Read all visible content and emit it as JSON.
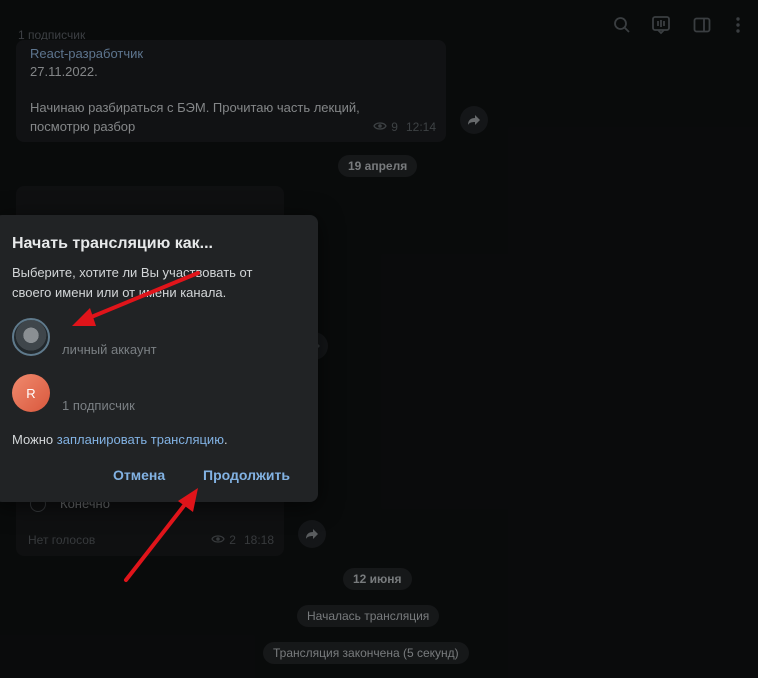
{
  "header": {
    "subscribers": "1 подписчик",
    "icons": [
      "search-icon",
      "stream-icon",
      "sidebar-toggle-icon",
      "more-icon"
    ]
  },
  "messages": [
    {
      "link": "React-разработчик",
      "date": "27.11.2022.",
      "text": "Начинаю разбираться с БЭМ. Прочитаю часть лекций, посмотрю разбор",
      "views": "9",
      "time": "12:14"
    }
  ],
  "date_pills": {
    "april": "19 апреля",
    "june": "12 июня"
  },
  "poll": {
    "option": "Конечно",
    "votes": "Нет голосов",
    "views": "2",
    "time": "18:18"
  },
  "service": {
    "started": "Началась трансляция",
    "ended": "Трансляция закончена (5 секунд)"
  },
  "dialog": {
    "title": "Начать трансляцию как...",
    "description": "Выберите, хотите ли Вы участвовать от своего имени или от имени канала.",
    "accounts": [
      {
        "subtitle": "личный аккаунт",
        "avatar": "photo"
      },
      {
        "subtitle": "1 подписчик",
        "avatar_letter": "R"
      }
    ],
    "schedule_prefix": "Можно ",
    "schedule_link": "запланировать трансляцию",
    "schedule_suffix": ".",
    "cancel": "Отмена",
    "continue": "Продолжить"
  },
  "colors": {
    "accent": "#82b2e3",
    "annotation_arrow": "#e0141a"
  }
}
